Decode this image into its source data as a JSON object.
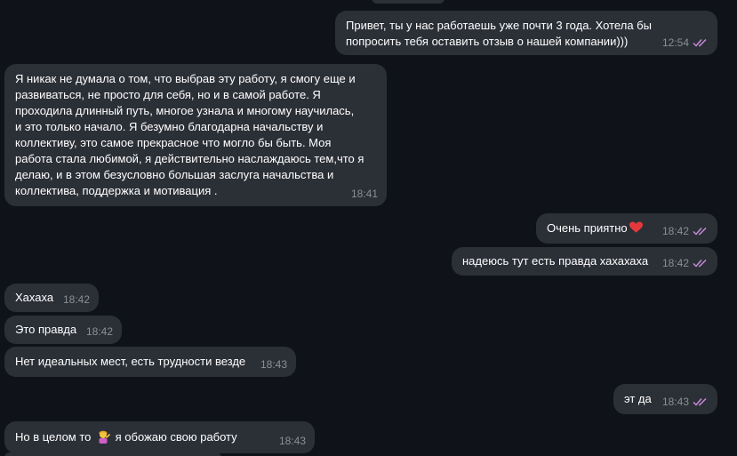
{
  "accent": "#c58bd6",
  "bubble_color": "#2b2f36",
  "background": "#0f1319",
  "messages": [
    {
      "direction": "out",
      "text": "Привет, ты у нас работаешь уже почти 3 года. Хотела бы\nпопросить тебя оставить отзыв о нашей компании)))",
      "time": "12:54",
      "status": "read"
    },
    {
      "direction": "in",
      "text": "Я никак не думала о том, что выбрав эту работу, я смогу еще и\nразвиваться, не просто для себя, но и в самой работе. Я\nпроходила длинный путь, многое узнала и многому научилась,\nи это только начало. Я безумно благодарна начальству и\nколлективу, это самое прекрасное что могло бы быть. Моя\nработа стала любимой, я действительно наслаждаюсь тем,что я\nделаю, и в этом безусловно большая заслуга начальства и\nколлектива, поддержка и мотивация .",
      "time": "18:41"
    },
    {
      "direction": "out",
      "text": "Очень приятно",
      "emoji": "heart-icon",
      "time": "18:42",
      "status": "read"
    },
    {
      "direction": "out",
      "text": "надеюсь тут есть правда хахахаха",
      "time": "18:42",
      "status": "read"
    },
    {
      "direction": "in",
      "text": "Хахаха",
      "time": "18:42"
    },
    {
      "direction": "in",
      "text": "Это правда",
      "time": "18:42"
    },
    {
      "direction": "in",
      "text": "Нет идеальных мест, есть трудности везде",
      "time": "18:43"
    },
    {
      "direction": "out",
      "text": "эт да",
      "time": "18:43",
      "status": "read"
    },
    {
      "direction": "in",
      "text_before": "Но в целом то",
      "emoji": "person-gesturing-emoji",
      "text_after": "я обожаю свою работу",
      "time": "18:43"
    }
  ]
}
